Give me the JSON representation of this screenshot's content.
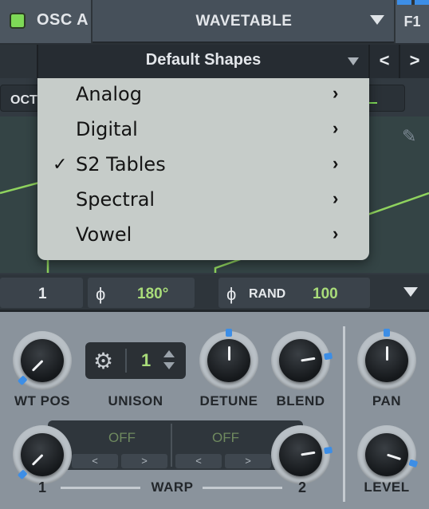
{
  "header": {
    "osc_name": "OSC A",
    "wavetable_name": "WAVETABLE",
    "fx_label": "F1",
    "accent": "#7ed957",
    "blue_accent": "#3d8ee6"
  },
  "shapes": {
    "name": "Default Shapes",
    "prev_label": "<",
    "next_label": ">"
  },
  "display": {
    "oct_label": "OCT",
    "edit_icon": "pencil-icon"
  },
  "params": {
    "value1": "1",
    "phase_symbol": "ϕ",
    "phase_value": "180°",
    "rand_label": "RAND",
    "rand_value": "100"
  },
  "menu": {
    "items": [
      {
        "label": "Analog",
        "checked": false,
        "arrow": "›"
      },
      {
        "label": "Digital",
        "checked": false,
        "arrow": "›"
      },
      {
        "label": "S2 Tables",
        "checked": true,
        "arrow": "›"
      },
      {
        "label": "Spectral",
        "checked": false,
        "arrow": "›"
      },
      {
        "label": "Vowel",
        "checked": false,
        "arrow": "›"
      }
    ],
    "check_mark": "✓"
  },
  "controls": {
    "wt_pos": {
      "label": "WT POS",
      "value": 0.0
    },
    "unison": {
      "label": "UNISON",
      "value": "1",
      "icon": "gear-icon"
    },
    "detune": {
      "label": "DETUNE",
      "value": 0.5
    },
    "blend": {
      "label": "BLEND",
      "value": 0.8
    },
    "pan": {
      "label": "PAN",
      "value": 0.5
    },
    "level": {
      "label": "LEVEL",
      "value": 0.9
    },
    "warp": {
      "label": "WARP",
      "left_num": "1",
      "right_num": "2",
      "slot1_value": "OFF",
      "slot2_value": "OFF",
      "prev_label": "<",
      "next_label": ">"
    }
  }
}
